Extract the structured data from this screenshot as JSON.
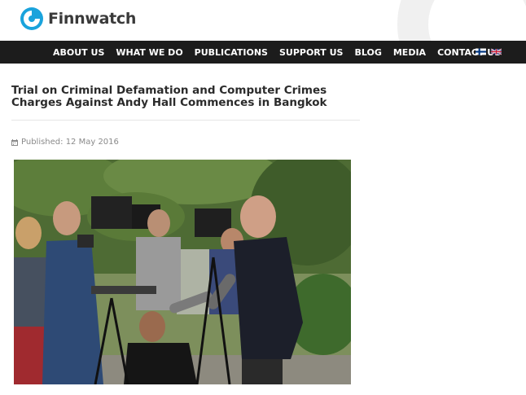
{
  "site": {
    "logo_text": "Finnwatch",
    "logo_icon": "finnwatch-logo-icon"
  },
  "nav": {
    "items": [
      {
        "label": "ABOUT US"
      },
      {
        "label": "WHAT WE DO"
      },
      {
        "label": "PUBLICATIONS"
      },
      {
        "label": "SUPPORT US"
      },
      {
        "label": "BLOG"
      },
      {
        "label": "MEDIA"
      },
      {
        "label": "CONTACT US"
      }
    ],
    "languages": [
      {
        "icon": "finnish-flag-icon"
      },
      {
        "icon": "uk-flag-icon"
      }
    ]
  },
  "article": {
    "title": "Trial on Criminal Defamation and Computer Crimes Charges Against Andy Hall Commences in Bangkok",
    "published": "Published: 12 May 2016",
    "image_icon": "press-conference-photo"
  },
  "colors": {
    "brand": "#1aa3dc",
    "nav_bg": "#1c1c1c",
    "text": "#2b2b2b",
    "muted": "#8a8a8a"
  }
}
